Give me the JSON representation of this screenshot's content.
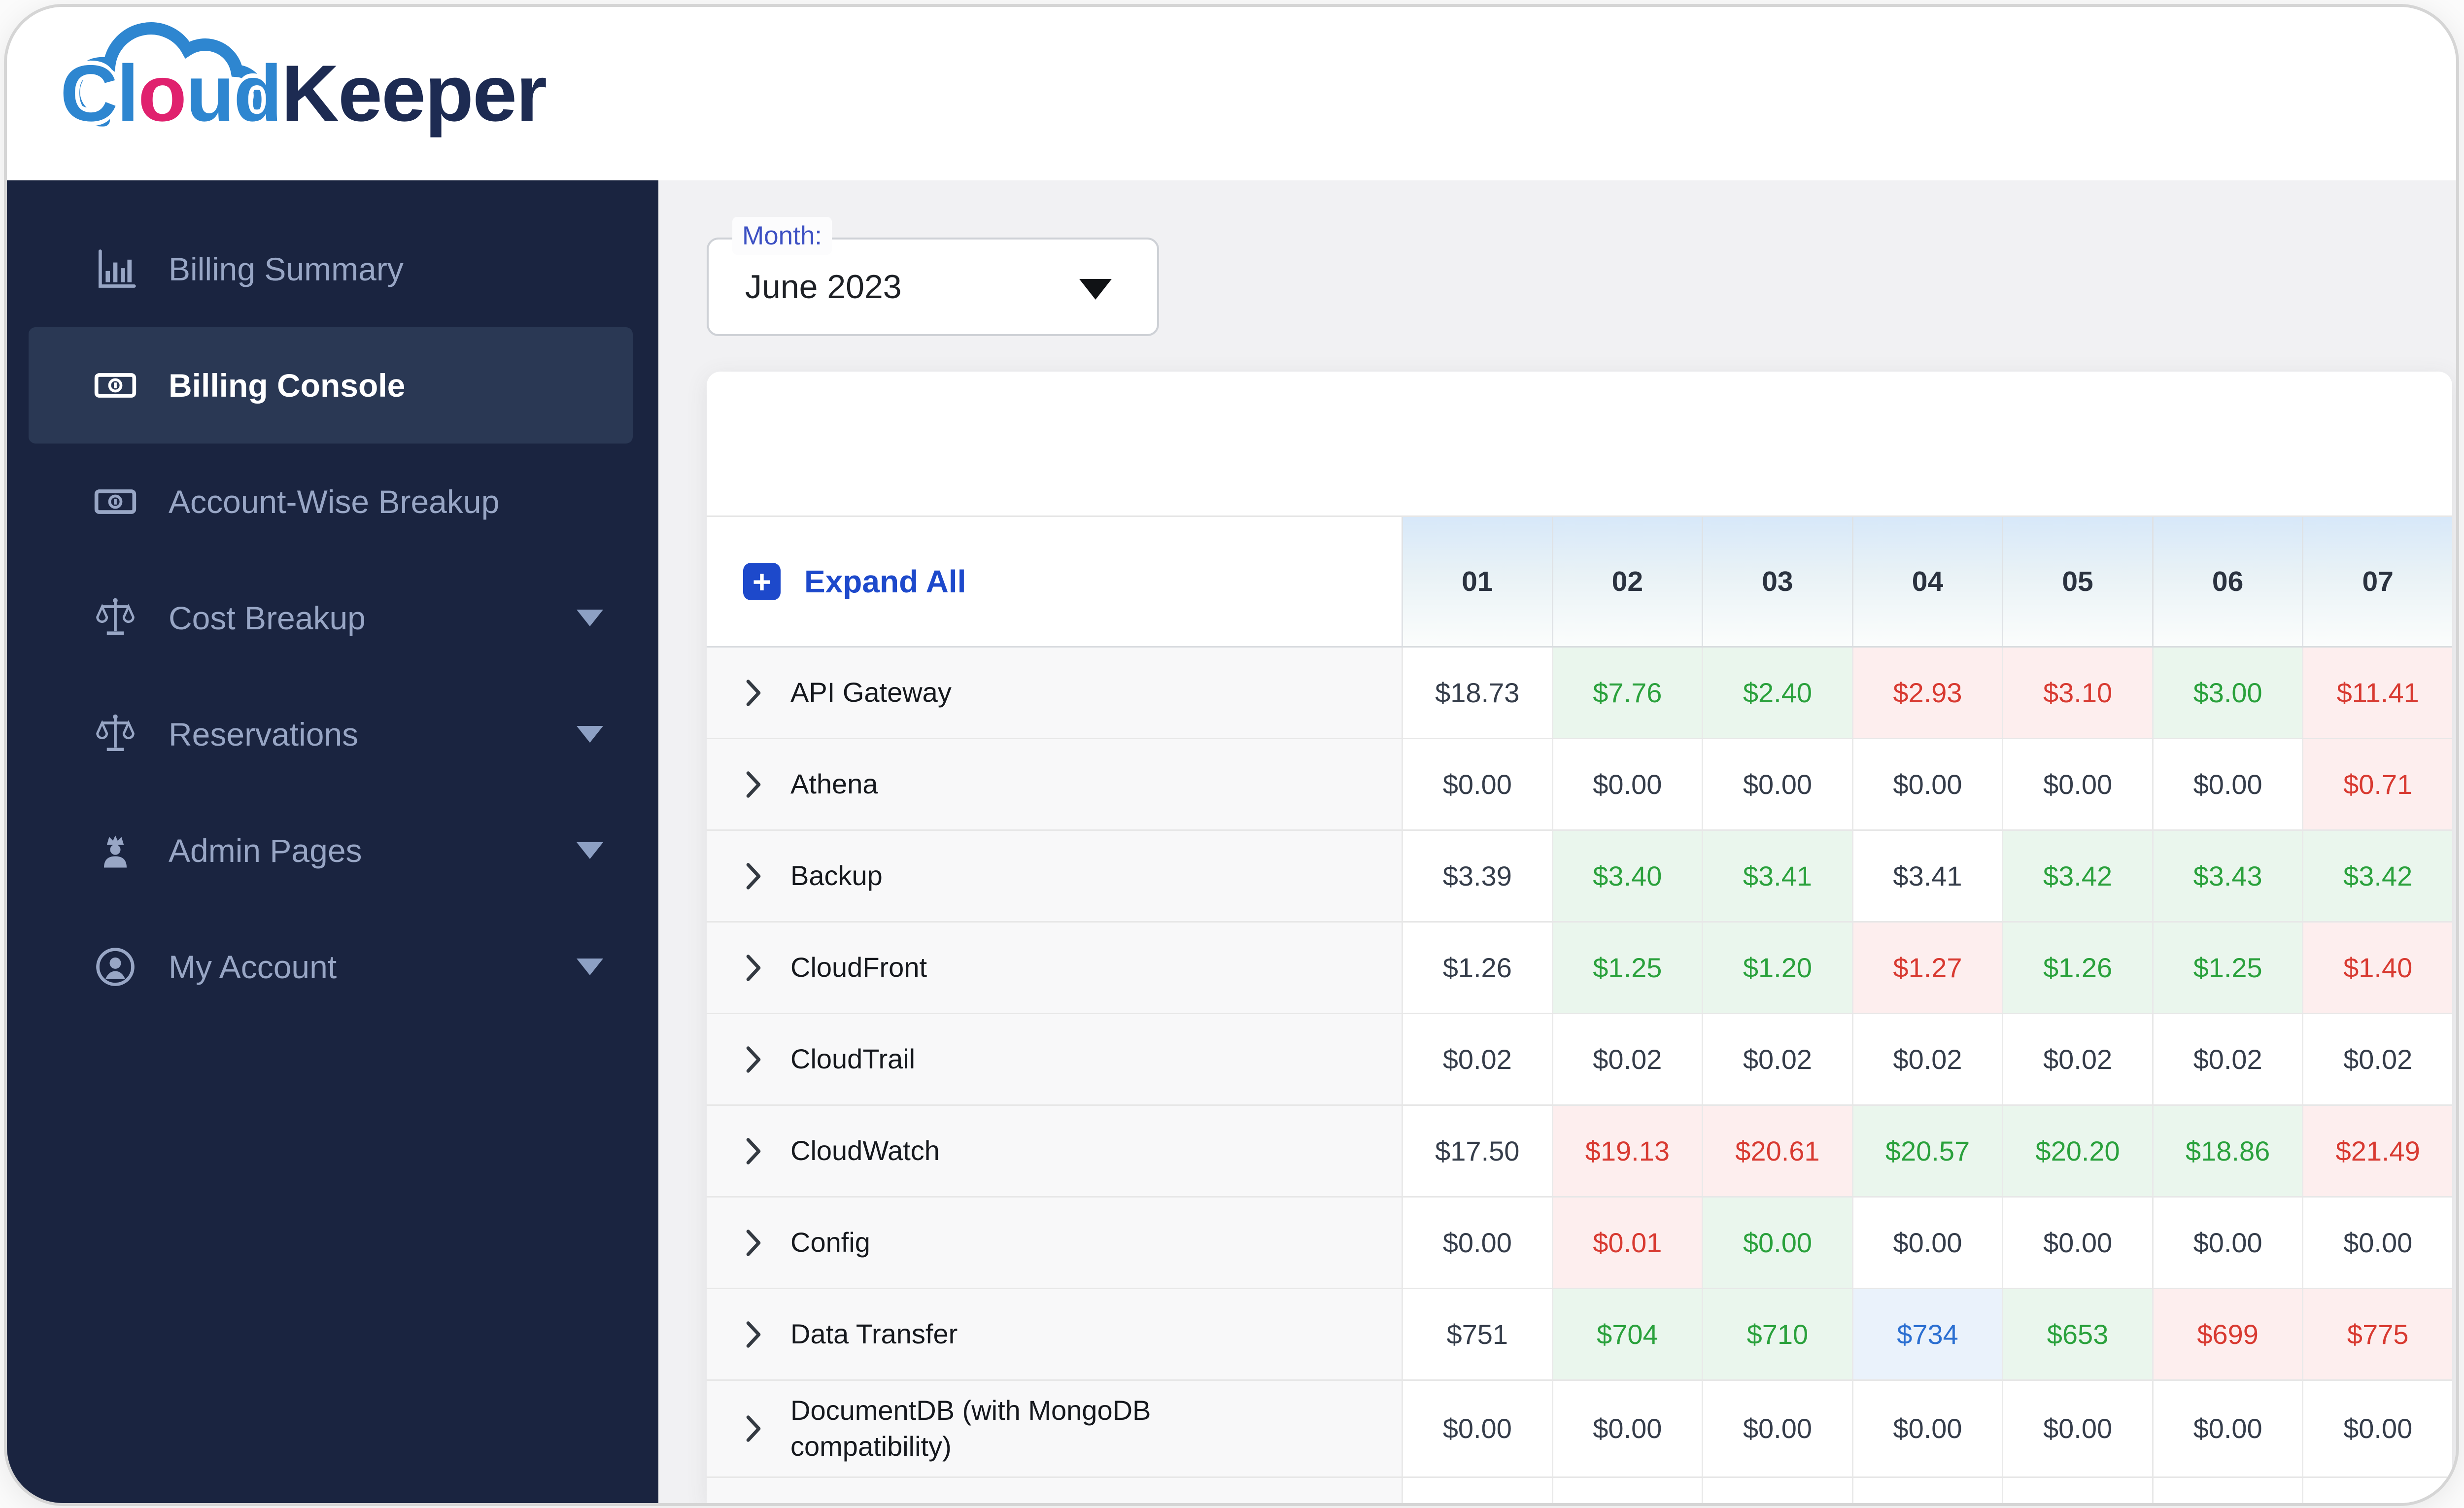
{
  "brand": {
    "logo_part_cl": "Cl",
    "logo_part_o": "o",
    "logo_part_ud": "ud",
    "logo_part_keeper": "Keeper",
    "brand_blue": "#2e86d0",
    "brand_pink": "#e0216e",
    "brand_navy": "#1d2b52"
  },
  "sidebar": {
    "bg_color": "#1a2440",
    "active_bg_color": "#2a3854",
    "items": [
      {
        "label": "Billing Summary",
        "icon": "bar-chart-icon",
        "active": false,
        "chevron": false
      },
      {
        "label": "Billing Console",
        "icon": "banknote-icon",
        "active": true,
        "chevron": false
      },
      {
        "label": "Account-Wise Breakup",
        "icon": "banknote-icon",
        "active": false,
        "chevron": false
      },
      {
        "label": "Cost Breakup",
        "icon": "scale-icon",
        "active": false,
        "chevron": true
      },
      {
        "label": "Reservations",
        "icon": "scale-icon",
        "active": false,
        "chevron": true
      },
      {
        "label": "Admin Pages",
        "icon": "admin-icon",
        "active": false,
        "chevron": true
      },
      {
        "label": "My Account",
        "icon": "user-circle-icon",
        "active": false,
        "chevron": true
      }
    ]
  },
  "filters": {
    "month_label": "Month:",
    "month_value": "June 2023"
  },
  "table": {
    "expand_all_label": "Expand All",
    "accent_blue": "#1d49cb",
    "status_colors": {
      "green": "#2aa13c",
      "red": "#d83a31",
      "blue": "#2b6fd1",
      "default": "#353d4a"
    },
    "day_columns": [
      "01",
      "02",
      "03",
      "04",
      "05",
      "06",
      "07"
    ],
    "rows": [
      {
        "service": "API Gateway",
        "cells": [
          {
            "t": "$18.73",
            "s": "k"
          },
          {
            "t": "$7.76",
            "s": "g"
          },
          {
            "t": "$2.40",
            "s": "g"
          },
          {
            "t": "$2.93",
            "s": "r"
          },
          {
            "t": "$3.10",
            "s": "r"
          },
          {
            "t": "$3.00",
            "s": "g"
          },
          {
            "t": "$11.41",
            "s": "r"
          }
        ]
      },
      {
        "service": "Athena",
        "cells": [
          {
            "t": "$0.00",
            "s": "k"
          },
          {
            "t": "$0.00",
            "s": "k"
          },
          {
            "t": "$0.00",
            "s": "k"
          },
          {
            "t": "$0.00",
            "s": "k"
          },
          {
            "t": "$0.00",
            "s": "k"
          },
          {
            "t": "$0.00",
            "s": "k"
          },
          {
            "t": "$0.71",
            "s": "r"
          }
        ]
      },
      {
        "service": "Backup",
        "cells": [
          {
            "t": "$3.39",
            "s": "k"
          },
          {
            "t": "$3.40",
            "s": "g"
          },
          {
            "t": "$3.41",
            "s": "g"
          },
          {
            "t": "$3.41",
            "s": "k"
          },
          {
            "t": "$3.42",
            "s": "g"
          },
          {
            "t": "$3.43",
            "s": "g"
          },
          {
            "t": "$3.42",
            "s": "g"
          }
        ]
      },
      {
        "service": "CloudFront",
        "cells": [
          {
            "t": "$1.26",
            "s": "k"
          },
          {
            "t": "$1.25",
            "s": "g"
          },
          {
            "t": "$1.20",
            "s": "g"
          },
          {
            "t": "$1.27",
            "s": "r"
          },
          {
            "t": "$1.26",
            "s": "g"
          },
          {
            "t": "$1.25",
            "s": "g"
          },
          {
            "t": "$1.40",
            "s": "r"
          }
        ]
      },
      {
        "service": "CloudTrail",
        "cells": [
          {
            "t": "$0.02",
            "s": "k"
          },
          {
            "t": "$0.02",
            "s": "k"
          },
          {
            "t": "$0.02",
            "s": "k"
          },
          {
            "t": "$0.02",
            "s": "k"
          },
          {
            "t": "$0.02",
            "s": "k"
          },
          {
            "t": "$0.02",
            "s": "k"
          },
          {
            "t": "$0.02",
            "s": "k"
          }
        ]
      },
      {
        "service": "CloudWatch",
        "cells": [
          {
            "t": "$17.50",
            "s": "k"
          },
          {
            "t": "$19.13",
            "s": "r"
          },
          {
            "t": "$20.61",
            "s": "r"
          },
          {
            "t": "$20.57",
            "s": "g"
          },
          {
            "t": "$20.20",
            "s": "g"
          },
          {
            "t": "$18.86",
            "s": "g"
          },
          {
            "t": "$21.49",
            "s": "r"
          }
        ]
      },
      {
        "service": "Config",
        "cells": [
          {
            "t": "$0.00",
            "s": "k"
          },
          {
            "t": "$0.01",
            "s": "r"
          },
          {
            "t": "$0.00",
            "s": "g"
          },
          {
            "t": "$0.00",
            "s": "k"
          },
          {
            "t": "$0.00",
            "s": "k"
          },
          {
            "t": "$0.00",
            "s": "k"
          },
          {
            "t": "$0.00",
            "s": "k"
          }
        ]
      },
      {
        "service": "Data Transfer",
        "cells": [
          {
            "t": "$751",
            "s": "k"
          },
          {
            "t": "$704",
            "s": "g"
          },
          {
            "t": "$710",
            "s": "g"
          },
          {
            "t": "$734",
            "s": "b"
          },
          {
            "t": "$653",
            "s": "g"
          },
          {
            "t": "$699",
            "s": "r"
          },
          {
            "t": "$775",
            "s": "r"
          }
        ]
      },
      {
        "service": "DocumentDB (with MongoDB compatibility)",
        "cells": [
          {
            "t": "$0.00",
            "s": "k"
          },
          {
            "t": "$0.00",
            "s": "k"
          },
          {
            "t": "$0.00",
            "s": "k"
          },
          {
            "t": "$0.00",
            "s": "k"
          },
          {
            "t": "$0.00",
            "s": "k"
          },
          {
            "t": "$0.00",
            "s": "k"
          },
          {
            "t": "$0.00",
            "s": "k"
          }
        ]
      }
    ]
  }
}
